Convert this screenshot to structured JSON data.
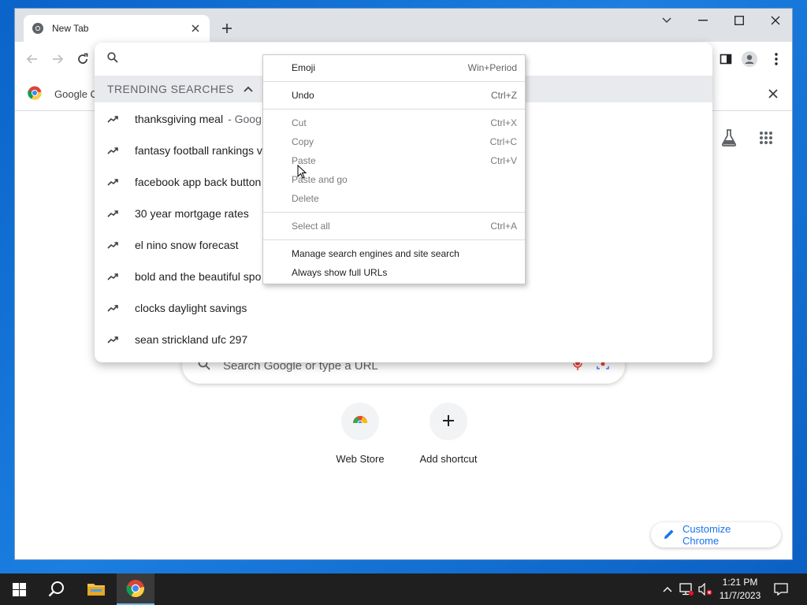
{
  "browser": {
    "tab": {
      "title": "New Tab"
    },
    "bookmark": {
      "label": "Google C"
    }
  },
  "omnibox": {
    "trending_header": "TRENDING SEARCHES",
    "suggestions": [
      {
        "text": "thanksgiving meal",
        "sub": "- Goog"
      },
      {
        "text": "fantasy football rankings v",
        "sub": ""
      },
      {
        "text": "facebook app back button",
        "sub": ""
      },
      {
        "text": "30 year mortgage rates",
        "sub": ""
      },
      {
        "text": "el nino snow forecast",
        "sub": ""
      },
      {
        "text": "bold and the beautiful spo",
        "sub": ""
      },
      {
        "text": "clocks daylight savings",
        "sub": ""
      },
      {
        "text": "sean strickland ufc 297",
        "sub": ""
      }
    ]
  },
  "context_menu": {
    "emoji": {
      "label": "Emoji",
      "shortcut": "Win+Period"
    },
    "undo": {
      "label": "Undo",
      "shortcut": "Ctrl+Z"
    },
    "cut": {
      "label": "Cut",
      "shortcut": "Ctrl+X"
    },
    "copy": {
      "label": "Copy",
      "shortcut": "Ctrl+C"
    },
    "paste": {
      "label": "Paste",
      "shortcut": "Ctrl+V"
    },
    "paste_go": {
      "label": "Paste and go"
    },
    "delete": {
      "label": "Delete"
    },
    "select_all": {
      "label": "Select all",
      "shortcut": "Ctrl+A"
    },
    "manage": {
      "label": "Manage search engines and site search"
    },
    "full_urls": {
      "label": "Always show full URLs"
    }
  },
  "ntp": {
    "search_placeholder": "Search Google or type a URL",
    "shortcuts": [
      {
        "label": "Web Store"
      },
      {
        "label": "Add shortcut"
      }
    ],
    "customize_label": "Customize Chrome"
  },
  "taskbar": {
    "time": "1:21 PM",
    "date": "11/7/2023"
  },
  "colors": {
    "accent": "#1a73e8",
    "tabstrip": "#dee1e6",
    "taskbar": "#1f1f1f"
  }
}
